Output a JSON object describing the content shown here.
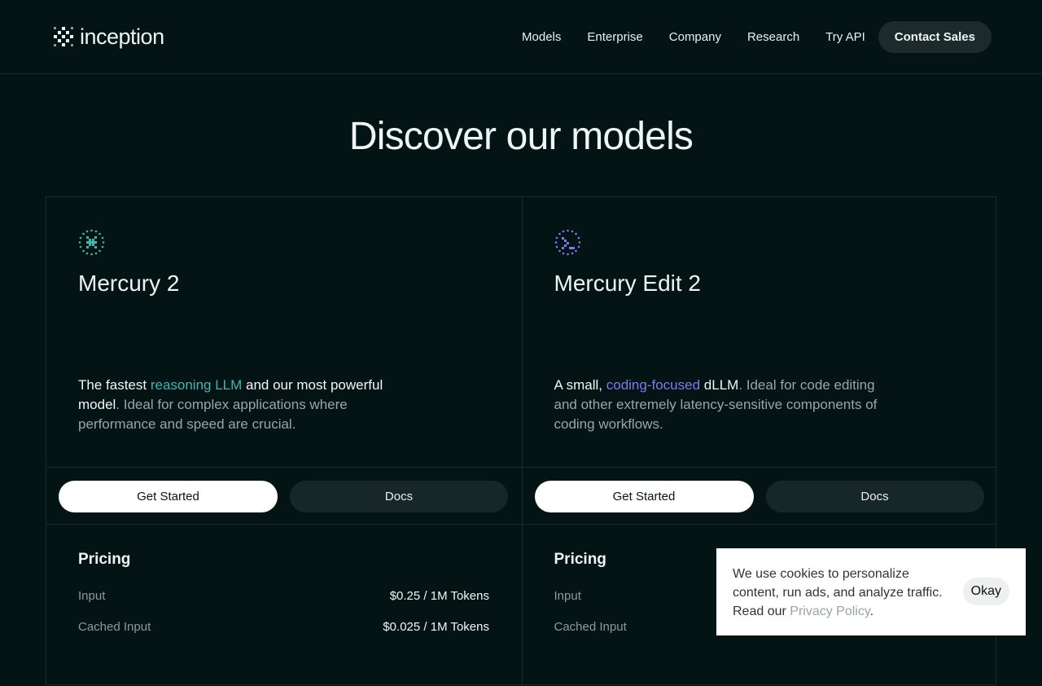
{
  "header": {
    "logo_text": "inception",
    "nav": [
      "Models",
      "Enterprise",
      "Company",
      "Research",
      "Try API"
    ],
    "cta": "Contact Sales"
  },
  "hero": {
    "title": "Discover our models"
  },
  "models": [
    {
      "name": "Mercury 2",
      "icon": "mercury-grid-icon",
      "accent": "#3fb7b0",
      "desc_prefix": "The fastest ",
      "desc_accent": "reasoning LLM",
      "desc_strong": " and our most powerful model",
      "desc_rest": ". Ideal for complex applications where performance and speed are crucial.",
      "primary": "Get Started",
      "secondary": "Docs",
      "pricing_title": "Pricing",
      "pricing": [
        {
          "label": "Input",
          "value": "$0.25 / 1M Tokens"
        },
        {
          "label": "Cached Input",
          "value": "$0.025 / 1M Tokens"
        }
      ]
    },
    {
      "name": "Mercury Edit 2",
      "icon": "terminal-prompt-icon",
      "accent": "#7c7bf0",
      "desc_prefix": "A small, ",
      "desc_accent": "coding-focused",
      "desc_strong": " dLLM",
      "desc_rest": ". Ideal for code editing and other extremely latency-sensitive components of coding workflows.",
      "primary": "Get Started",
      "secondary": "Docs",
      "pricing_title": "Pricing",
      "pricing": [
        {
          "label": "Input",
          "value": ""
        },
        {
          "label": "Cached Input",
          "value": ""
        }
      ]
    }
  ],
  "cookie": {
    "text": "We use cookies to personalize content, run ads, and analyze traffic. Read our ",
    "link": "Privacy Policy",
    "suffix": ".",
    "button": "Okay"
  }
}
